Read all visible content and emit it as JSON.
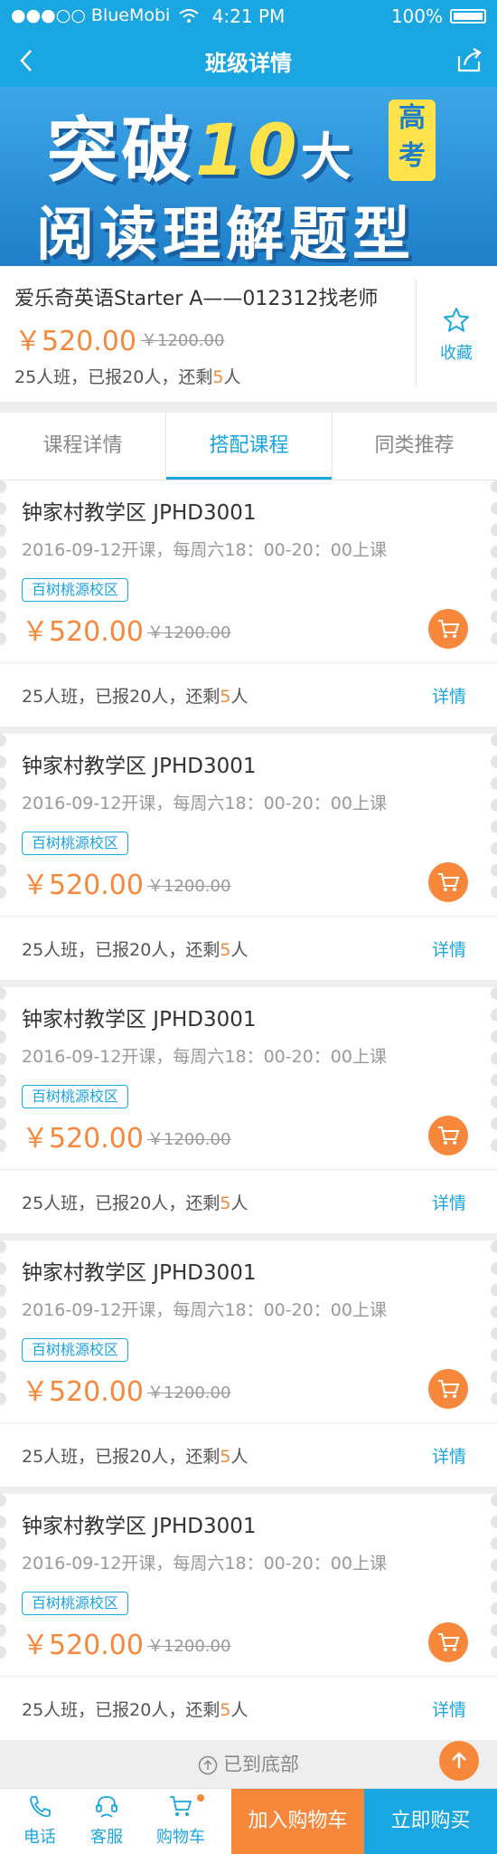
{
  "status": {
    "carrier": "●●●○○ BlueMobi",
    "time": "4:21 PM",
    "battery": "100%"
  },
  "nav": {
    "title": "班级详情"
  },
  "banner": {
    "line1_a": "突破",
    "line1_num": "10",
    "line1_b": "大",
    "tag": "高考",
    "line2": "阅读理解题型"
  },
  "course": {
    "name": "爱乐奇英语Starter A——012312找老师",
    "price": "￥520.00",
    "old_price": "￥1200.00",
    "seats_prefix": "25人班，已报20人，还剩",
    "seats_left": "5",
    "seats_suffix": "人",
    "favorite_label": "收藏"
  },
  "tabs": [
    {
      "label": "课程详情"
    },
    {
      "label": "搭配课程"
    },
    {
      "label": "同类推荐"
    }
  ],
  "cards": [
    {
      "title": "钟家村教学区 JPHD3001",
      "schedule": "2016-09-12开课，每周六18：00-20：00上课",
      "campus": "百树桃源校区",
      "price": "￥520.00",
      "old_price": "￥1200.00",
      "seats_prefix": "25人班，已报20人，还剩",
      "seats_left": "5",
      "seats_suffix": "人",
      "detail": "详情"
    },
    {
      "title": "钟家村教学区 JPHD3001",
      "schedule": "2016-09-12开课，每周六18：00-20：00上课",
      "campus": "百树桃源校区",
      "price": "￥520.00",
      "old_price": "￥1200.00",
      "seats_prefix": "25人班，已报20人，还剩",
      "seats_left": "5",
      "seats_suffix": "人",
      "detail": "详情"
    },
    {
      "title": "钟家村教学区 JPHD3001",
      "schedule": "2016-09-12开课，每周六18：00-20：00上课",
      "campus": "百树桃源校区",
      "price": "￥520.00",
      "old_price": "￥1200.00",
      "seats_prefix": "25人班，已报20人，还剩",
      "seats_left": "5",
      "seats_suffix": "人",
      "detail": "详情"
    },
    {
      "title": "钟家村教学区 JPHD3001",
      "schedule": "2016-09-12开课，每周六18：00-20：00上课",
      "campus": "百树桃源校区",
      "price": "￥520.00",
      "old_price": "￥1200.00",
      "seats_prefix": "25人班，已报20人，还剩",
      "seats_left": "5",
      "seats_suffix": "人",
      "detail": "详情"
    },
    {
      "title": "钟家村教学区 JPHD3001",
      "schedule": "2016-09-12开课，每周六18：00-20：00上课",
      "campus": "百树桃源校区",
      "price": "￥520.00",
      "old_price": "￥1200.00",
      "seats_prefix": "25人班，已报20人，还剩",
      "seats_left": "5",
      "seats_suffix": "人",
      "detail": "详情"
    }
  ],
  "bottom_hint": "已到底部",
  "tabbar": {
    "phone_label": "电话",
    "service_label": "客服",
    "cart_label": "购物车",
    "add_cart_label": "加入购物车",
    "buy_now_label": "立即购买"
  },
  "colors": {
    "primary": "#1aa6e0",
    "accent": "#f7883b"
  }
}
